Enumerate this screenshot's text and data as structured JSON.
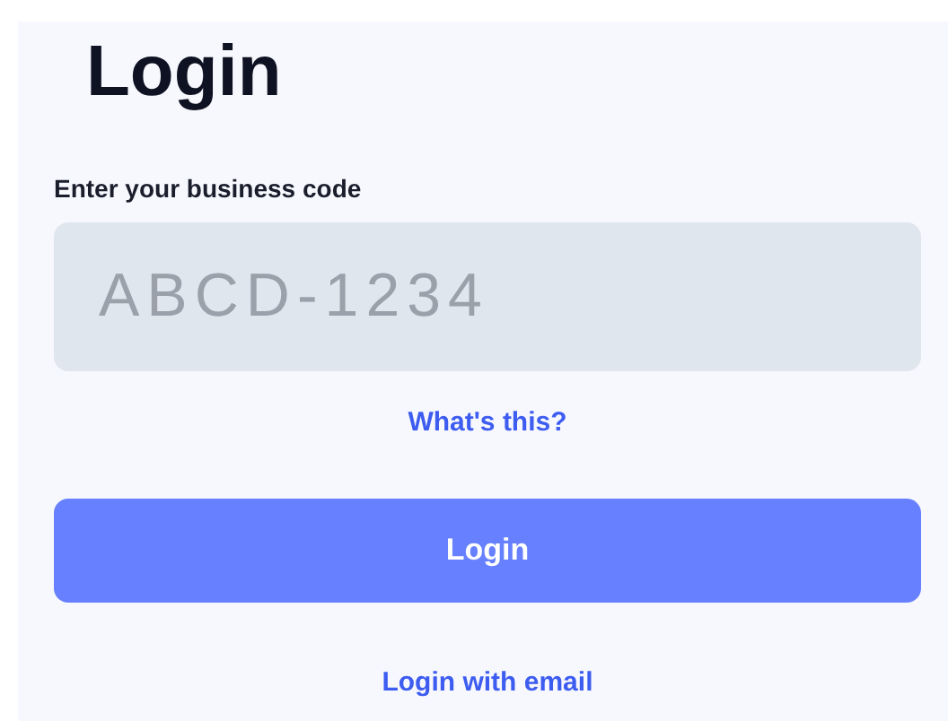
{
  "title": "Login",
  "field": {
    "label": "Enter your business code",
    "placeholder": "ABCD-1234"
  },
  "help_link": "What's this?",
  "submit_button": "Login",
  "alt_link": "Login with email"
}
